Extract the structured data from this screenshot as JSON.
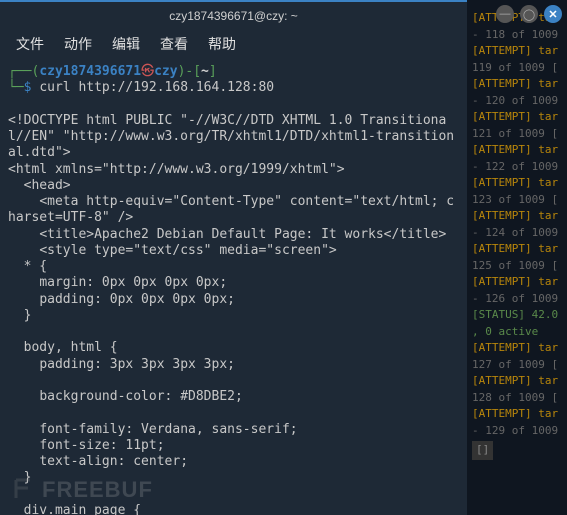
{
  "bg": {
    "lines": [
      {
        "t": "[ATTEMPT] tar",
        "c": "bg-line"
      },
      {
        "t": "- 118 of 1009",
        "c": "bg-dim"
      },
      {
        "t": "[ATTEMPT] tar",
        "c": "bg-line"
      },
      {
        "t": "119 of 1009 [",
        "c": "bg-dim"
      },
      {
        "t": "[ATTEMPT] tar",
        "c": "bg-line"
      },
      {
        "t": "- 120 of 1009",
        "c": "bg-dim"
      },
      {
        "t": "[ATTEMPT] tar",
        "c": "bg-line"
      },
      {
        "t": "121 of 1009 [",
        "c": "bg-dim"
      },
      {
        "t": "[ATTEMPT] tar",
        "c": "bg-line"
      },
      {
        "t": "- 122 of 1009",
        "c": "bg-dim"
      },
      {
        "t": "[ATTEMPT] tar",
        "c": "bg-line"
      },
      {
        "t": "123 of 1009 [",
        "c": "bg-dim"
      },
      {
        "t": "[ATTEMPT] tar",
        "c": "bg-line"
      },
      {
        "t": "- 124 of 1009",
        "c": "bg-dim"
      },
      {
        "t": "[ATTEMPT] tar",
        "c": "bg-line"
      },
      {
        "t": "125 of 1009 [",
        "c": "bg-dim"
      },
      {
        "t": "[ATTEMPT] tar",
        "c": "bg-line"
      },
      {
        "t": "- 126 of 1009",
        "c": "bg-dim"
      },
      {
        "t": "[STATUS] 42.0",
        "c": "bg-status"
      },
      {
        "t": ", 0 active",
        "c": "bg-status"
      },
      {
        "t": "[ATTEMPT] tar",
        "c": "bg-line"
      },
      {
        "t": "127 of 1009 [",
        "c": "bg-dim"
      },
      {
        "t": "[ATTEMPT] tar",
        "c": "bg-line"
      },
      {
        "t": "128 of 1009 [",
        "c": "bg-dim"
      },
      {
        "t": "[ATTEMPT] tar",
        "c": "bg-line"
      },
      {
        "t": "- 129 of 1009",
        "c": "bg-dim"
      }
    ],
    "prompt": "[]"
  },
  "titlebar": {
    "title": "czy1874396671@czy: ~"
  },
  "win": {
    "min": "—",
    "max": "◯",
    "close": "✕"
  },
  "menu": {
    "file": "文件",
    "actions": "动作",
    "edit": "编辑",
    "view": "查看",
    "help": "帮助"
  },
  "prompt": {
    "open1": "┌──(",
    "user": "czy1874396671",
    "at": "㉿",
    "host": "czy",
    "close1": ")-[",
    "path": "~",
    "close2": "]",
    "line2a": "└─",
    "dollar": "$"
  },
  "command": "curl http://192.168.164.128:80",
  "output": "\n<!DOCTYPE html PUBLIC \"-//W3C//DTD XHTML 1.0 Transitional//EN\" \"http://www.w3.org/TR/xhtml1/DTD/xhtml1-transitional.dtd\">\n<html xmlns=\"http://www.w3.org/1999/xhtml\">\n  <head>\n    <meta http-equiv=\"Content-Type\" content=\"text/html; charset=UTF-8\" />\n    <title>Apache2 Debian Default Page: It works</title>\n    <style type=\"text/css\" media=\"screen\">\n  * {\n    margin: 0px 0px 0px 0px;\n    padding: 0px 0px 0px 0px;\n  }\n\n  body, html {\n    padding: 3px 3px 3px 3px;\n\n    background-color: #D8DBE2;\n\n    font-family: Verdana, sans-serif;\n    font-size: 11pt;\n    text-align: center;\n  }\n\n  div.main_page {",
  "watermark": "FREEBUF"
}
